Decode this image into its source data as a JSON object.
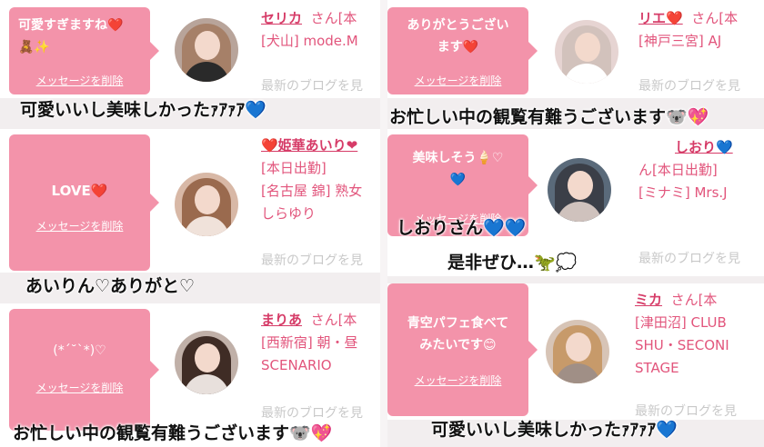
{
  "panels": [
    {
      "bubble_message": "可愛すぎますね❤️\n🧸✨",
      "delete_label": "メッセージを削除",
      "name": "セリカ",
      "honorific": "さん[本",
      "info_lines": [
        "[犬山] mode.M"
      ],
      "blog_label": "最新のブログを見",
      "caption": "可愛いいし美味しかったｧｱｧｱ💙"
    },
    {
      "bubble_message": "LOVE❤️",
      "delete_label": "メッセージを削除",
      "name": "❤️姫華あいり❤",
      "honorific": "",
      "info_lines": [
        "[本日出勤]",
        "[名古屋 錦] 熟女",
        "しらゆり"
      ],
      "blog_label": "最新のブログを見",
      "caption": "あいりん♡ありがと♡"
    },
    {
      "bubble_message": "(*´˘`*)♡",
      "delete_label": "メッセージを削除",
      "name": "まりあ",
      "honorific": "さん[本",
      "info_lines": [
        "[西新宿] 朝・昼",
        "SCENARIO"
      ],
      "blog_label": "最新のブログを見",
      "caption": "お忙しい中の観覧有難うございます🐨💖"
    },
    {
      "bubble_message": "ありがとうござい\nます❤️",
      "delete_label": "メッセージを削除",
      "name": "リエ❤️",
      "honorific": "さん[本",
      "info_lines": [
        "[神戸三宮] AJ"
      ],
      "blog_label": "最新のブログを見",
      "caption": "お忙しい中の観覧有難うございます🐨💖"
    },
    {
      "bubble_message": "美味しそう🍦♡\n💙",
      "delete_label": "メッセージを削除",
      "name": "しおり💙",
      "honorific": "",
      "info_lines": [
        "ん[本日出勤]",
        "[ミナミ] Mrs.J"
      ],
      "blog_label": "最新のブログを見",
      "caption": "しおりさん💙💙",
      "caption2": "是非ぜひ…🦖💭"
    },
    {
      "bubble_message": "青空パフェ食べて\nみたいです😊",
      "delete_label": "メッセージを削除",
      "name": "ミカ",
      "honorific": "さん[本",
      "info_lines": [
        "[津田沼] CLUB",
        "SHU・SECONI",
        "STAGE"
      ],
      "blog_label": "最新のブログを見",
      "caption": "可愛いいし美味しかったｧｱｧｱ💙"
    }
  ],
  "colors": {
    "bubble": "#f393aa",
    "name": "#d63c68",
    "info": "#e2557c",
    "blog": "#c9c9c9",
    "caption": "#111111"
  }
}
